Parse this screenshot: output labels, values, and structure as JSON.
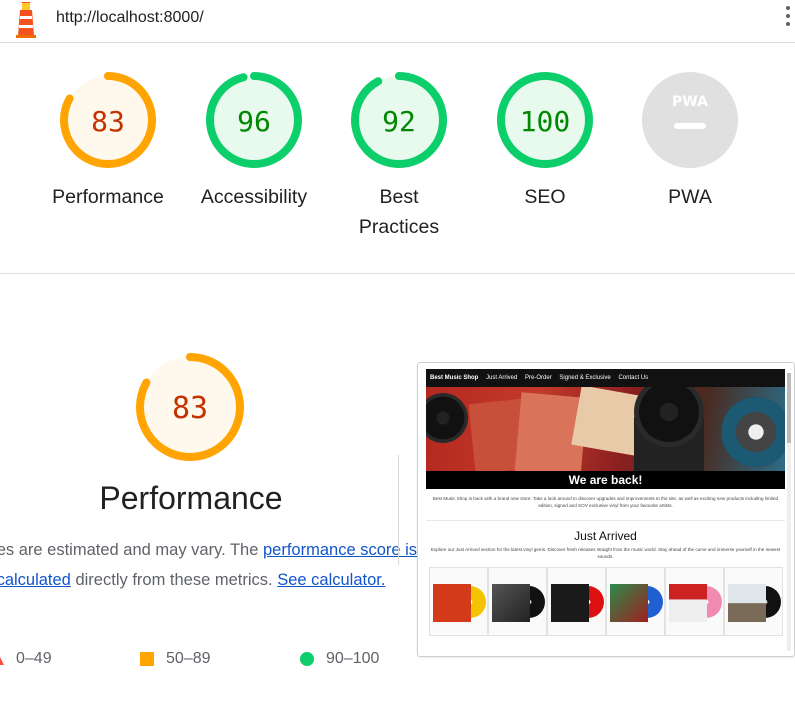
{
  "browser": {
    "url": "http://localhost:8000/"
  },
  "colors": {
    "orange": "#ffa400",
    "green": "#0cce6b",
    "red": "#ff4e42",
    "gray": "#e0e0e0"
  },
  "gauges": [
    {
      "score": "83",
      "label": "Performance",
      "status": "average"
    },
    {
      "score": "96",
      "label": "Accessibility",
      "status": "pass"
    },
    {
      "score": "92",
      "label": "Best Practices",
      "status": "pass"
    },
    {
      "score": "100",
      "label": "SEO",
      "status": "pass"
    },
    {
      "score": "",
      "label": "PWA",
      "status": "na",
      "badge": "PWA"
    }
  ],
  "performance": {
    "score": "83",
    "title": "Performance",
    "desc_start": "Values are estimated and may vary. The",
    "link_calc": "performance score is calculated",
    "desc_mid": "directly from these metrics.",
    "link_calculator": "See calculator."
  },
  "legend": {
    "fail": "0–49",
    "average": "50–89",
    "pass": "90–100"
  },
  "screenshot": {
    "nav": [
      "Best Music Shop",
      "Just Arrived",
      "Pre-Order",
      "Signed & Exclusive",
      "Contact Us"
    ],
    "hero_text": "We are back!",
    "intro": "Best Music Shop is back with a brand new store. Take a look around to discover upgrades and improvements to the site, as well as exciting new products including limited edition, signed and SOV exclusive vinyl from your favourite artists.",
    "section_title": "Just Arrived",
    "section_desc": "Explore our Just Arrived section for the latest vinyl gems. Discover fresh releases straight from the music world. Stay ahead of the curve and immerse yourself in the newest sounds."
  }
}
